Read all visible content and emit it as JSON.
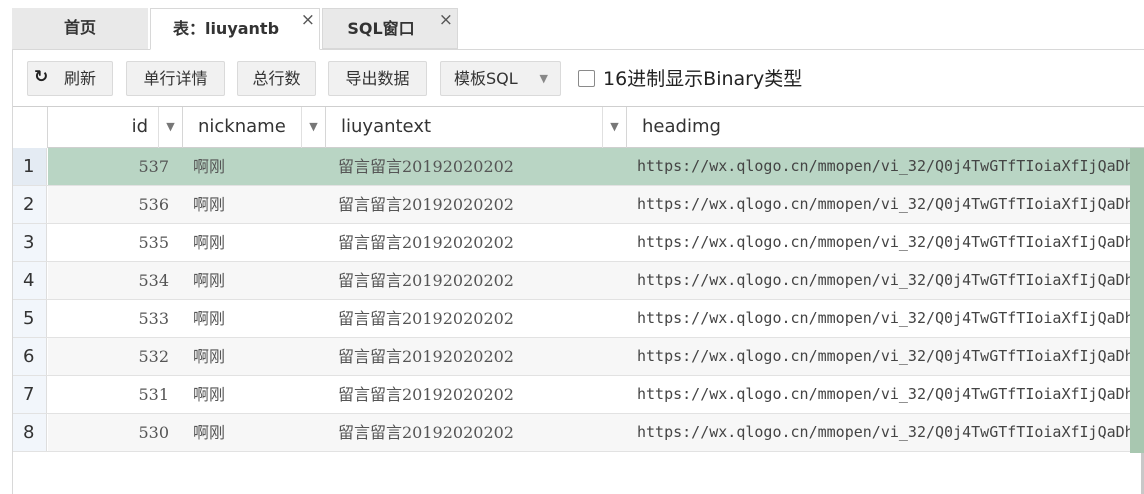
{
  "tabs": {
    "home": {
      "label": "首页"
    },
    "table": {
      "label": "表：liuyantb",
      "close": "×"
    },
    "sql": {
      "label": "SQL窗口",
      "close": "×"
    }
  },
  "toolbar": {
    "refresh_icon": "refresh-icon",
    "refresh": "刷新",
    "row_detail": "单行详情",
    "total_rows": "总行数",
    "export": "导出数据",
    "template_sql": "模板SQL",
    "hex_binary_label": "16进制显示Binary类型",
    "hex_binary_checked": false
  },
  "grid": {
    "columns": [
      "id",
      "nickname",
      "liuyantext",
      "headimg"
    ],
    "selected_row": 1,
    "rows": [
      {
        "num": "1",
        "id": "537",
        "nickname": "啊刚",
        "liuyantext": "留言留言20192020202",
        "headimg": "https://wx.qlogo.cn/mmopen/vi_32/Q0j4TwGTfTIoiaXfIjQaDh"
      },
      {
        "num": "2",
        "id": "536",
        "nickname": "啊刚",
        "liuyantext": "留言留言20192020202",
        "headimg": "https://wx.qlogo.cn/mmopen/vi_32/Q0j4TwGTfTIoiaXfIjQaDh"
      },
      {
        "num": "3",
        "id": "535",
        "nickname": "啊刚",
        "liuyantext": "留言留言20192020202",
        "headimg": "https://wx.qlogo.cn/mmopen/vi_32/Q0j4TwGTfTIoiaXfIjQaDh"
      },
      {
        "num": "4",
        "id": "534",
        "nickname": "啊刚",
        "liuyantext": "留言留言20192020202",
        "headimg": "https://wx.qlogo.cn/mmopen/vi_32/Q0j4TwGTfTIoiaXfIjQaDh"
      },
      {
        "num": "5",
        "id": "533",
        "nickname": "啊刚",
        "liuyantext": "留言留言20192020202",
        "headimg": "https://wx.qlogo.cn/mmopen/vi_32/Q0j4TwGTfTIoiaXfIjQaDh"
      },
      {
        "num": "6",
        "id": "532",
        "nickname": "啊刚",
        "liuyantext": "留言留言20192020202",
        "headimg": "https://wx.qlogo.cn/mmopen/vi_32/Q0j4TwGTfTIoiaXfIjQaDh"
      },
      {
        "num": "7",
        "id": "531",
        "nickname": "啊刚",
        "liuyantext": "留言留言20192020202",
        "headimg": "https://wx.qlogo.cn/mmopen/vi_32/Q0j4TwGTfTIoiaXfIjQaDh"
      },
      {
        "num": "8",
        "id": "530",
        "nickname": "啊刚",
        "liuyantext": "留言留言20192020202",
        "headimg": "https://wx.qlogo.cn/mmopen/vi_32/Q0j4TwGTfTIoiaXfIjQaDh"
      }
    ]
  },
  "colors": {
    "selected_row": "#b9d5c4",
    "alt_row": "#f7f7f7",
    "rownum_bg": "#f2f6fb"
  }
}
